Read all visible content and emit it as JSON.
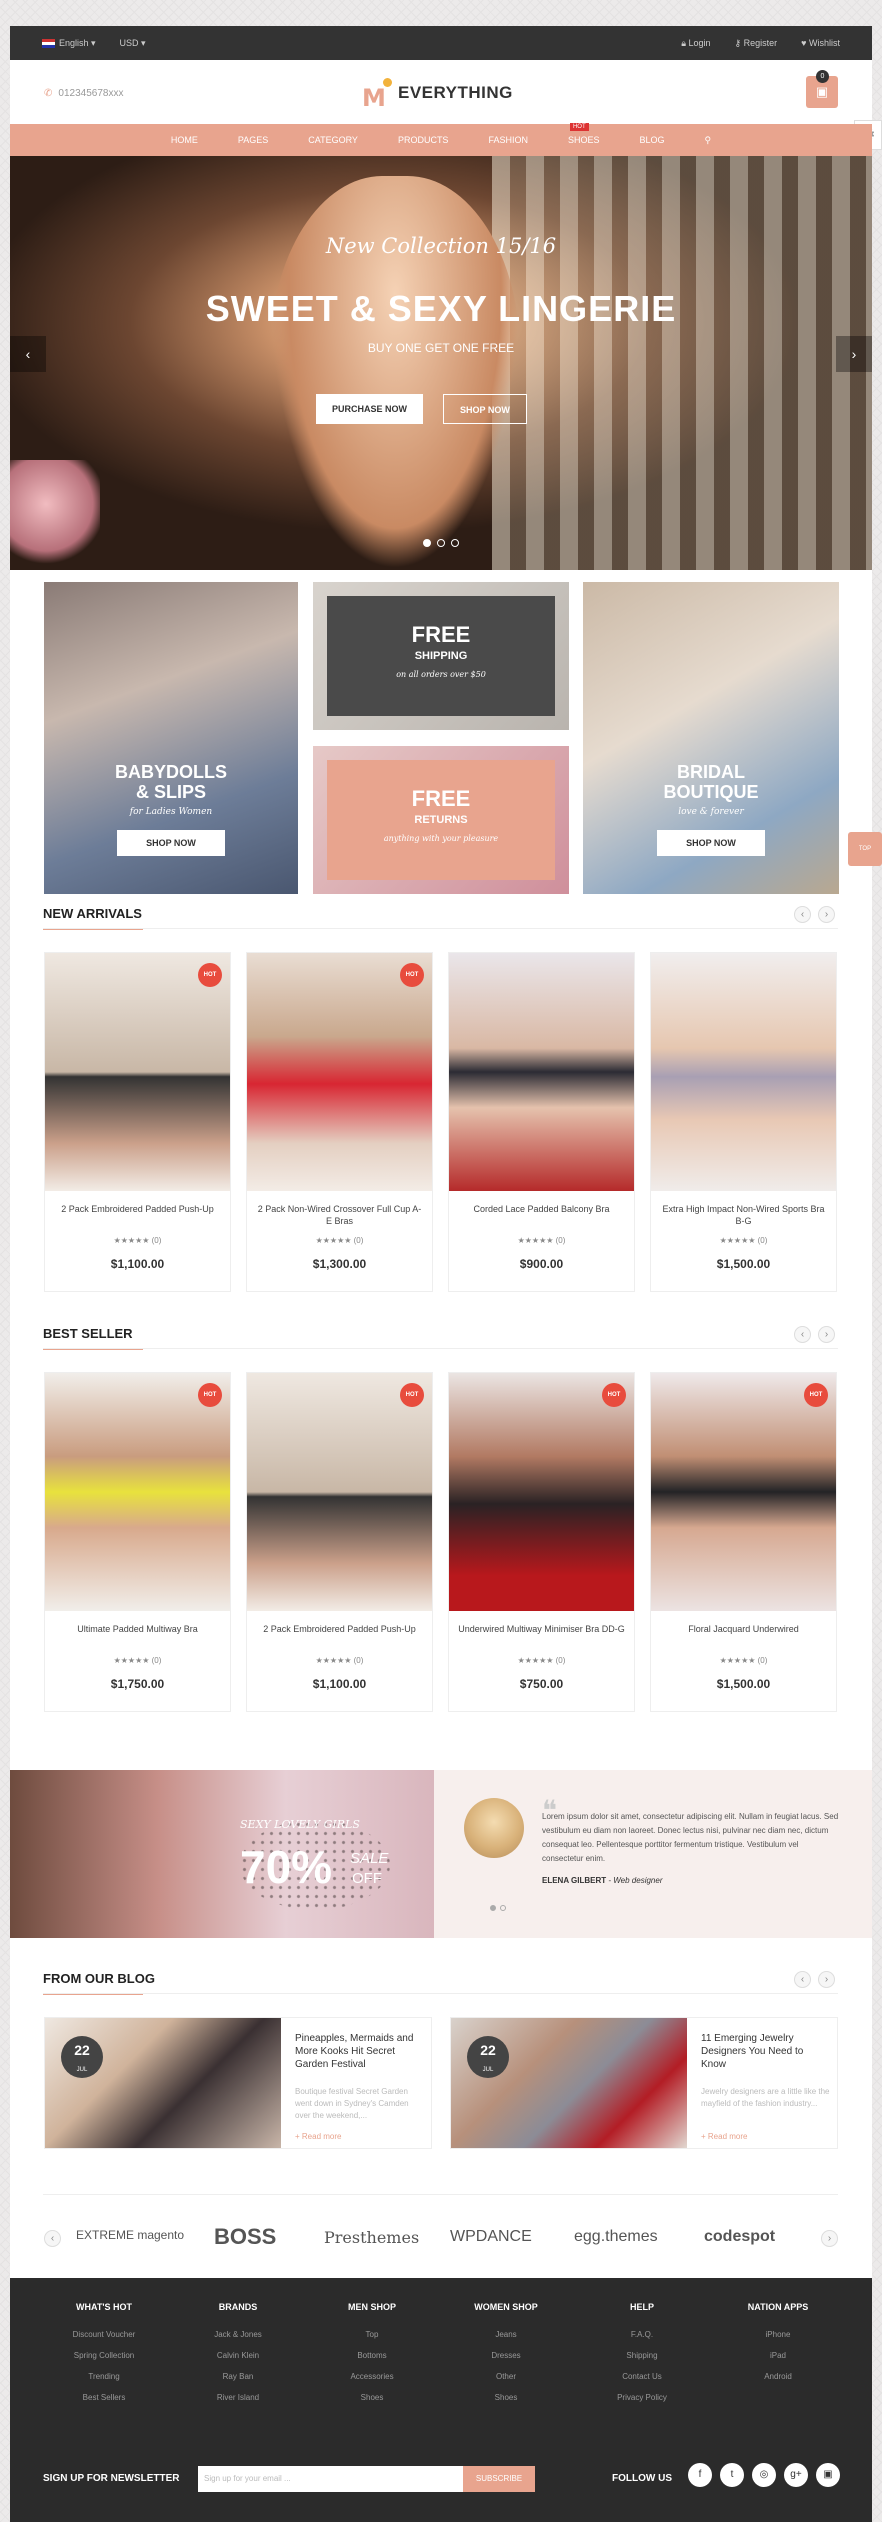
{
  "topbar": {
    "language": "English ▾",
    "currency": "USD ▾",
    "login": "Login",
    "register": "Register",
    "wishlist": "Wishlist"
  },
  "header": {
    "phone": "012345678xxx",
    "logo": "EVERYTHING",
    "cart_count": "0"
  },
  "nav": {
    "items": [
      "HOME",
      "PAGES",
      "CATEGORY",
      "PRODUCTS",
      "FASHION",
      "SHOES",
      "BLOG"
    ],
    "hot": "HOT"
  },
  "hero": {
    "subtitle": "New Collection 15/16",
    "title": "SWEET & SEXY LINGERIE",
    "tagline": "BUY ONE GET ONE FREE",
    "btn_purchase": "PURCHASE NOW",
    "btn_shop": "SHOP NOW"
  },
  "banners": {
    "babydolls": {
      "title": "BABYDOLLS",
      "title2": "& SLIPS",
      "sub": "for Ladies Women",
      "btn": "SHOP NOW"
    },
    "shipping": {
      "big": "FREE",
      "mid": "SHIPPING",
      "small": "on all orders over $50"
    },
    "returns": {
      "big": "FREE",
      "mid": "RETURNS",
      "small": "anything with your pleasure"
    },
    "bridal": {
      "title": "BRIDAL",
      "title2": "BOUTIQUE",
      "sub": "love & forever",
      "btn": "SHOP NOW"
    }
  },
  "new_arrivals": {
    "title": "NEW ARRIVALS",
    "products": [
      {
        "name": "2 Pack Embroidered Padded Push-Up",
        "reviews": "★★★★★ (0)",
        "price": "$1,100.00",
        "hot": "HOT"
      },
      {
        "name": "2 Pack Non-Wired Crossover Full Cup A-E Bras",
        "reviews": "★★★★★ (0)",
        "price": "$1,300.00",
        "hot": "HOT"
      },
      {
        "name": "Corded Lace Padded Balcony Bra",
        "reviews": "★★★★★ (0)",
        "price": "$900.00",
        "hot": ""
      },
      {
        "name": "Extra High Impact Non-Wired Sports Bra B-G",
        "reviews": "★★★★★ (0)",
        "price": "$1,500.00",
        "hot": ""
      }
    ]
  },
  "best_seller": {
    "title": "BEST SELLER",
    "products": [
      {
        "name": "Ultimate Padded Multiway Bra",
        "reviews": "★★★★★ (0)",
        "price": "$1,750.00",
        "hot": "HOT"
      },
      {
        "name": "2 Pack Embroidered Padded Push-Up",
        "reviews": "★★★★★ (0)",
        "price": "$1,100.00",
        "hot": "HOT"
      },
      {
        "name": "Underwired Multiway Minimiser Bra DD-G",
        "reviews": "★★★★★ (0)",
        "price": "$750.00",
        "hot": "HOT"
      },
      {
        "name": "Floral Jacquard Underwired",
        "reviews": "★★★★★ (0)",
        "price": "$1,500.00",
        "hot": "HOT"
      }
    ]
  },
  "promo": {
    "line1": "SEXY LOVELY GIRLS",
    "pct": "70%",
    "sale": "SALE",
    "off": "OFF"
  },
  "testimonial": {
    "text": "Lorem ipsum dolor sit amet, consectetur adipiscing elit. Nullam in feugiat lacus. Sed vestibulum eu diam non laoreet. Donec lectus nisi, pulvinar nec diam nec, dictum consequat leo. Pellentesque porttitor fermentum tristique. Vestibulum vel consectetur enim.",
    "name": "ELENA GILBERT",
    "role": " - Web designer"
  },
  "blog": {
    "title": "FROM OUR BLOG",
    "posts": [
      {
        "day": "22",
        "month": "JUL",
        "title": "Pineapples, Mermaids and More Kooks Hit Secret Garden Festival",
        "excerpt": "Boutique festival Secret Garden went down in Sydney's Camden over the weekend,...",
        "more": "+ Read more"
      },
      {
        "day": "22",
        "month": "JUL",
        "title": "11 Emerging Jewelry Designers You Need to Know",
        "excerpt": "Jewelry designers are a little like the mayfield of the fashion industry...",
        "more": "+ Read more"
      }
    ]
  },
  "brands": [
    "EXTREME magento",
    "BOSS",
    "Presthemes",
    "WPDANCE",
    "egg.themes",
    "codespot"
  ],
  "footer": {
    "columns": [
      {
        "title": "WHAT'S HOT",
        "links": [
          "Discount Voucher",
          "Spring Collection",
          "Trending",
          "Best Sellers"
        ]
      },
      {
        "title": "BRANDS",
        "links": [
          "Jack & Jones",
          "Calvin Klein",
          "Ray Ban",
          "River Island"
        ]
      },
      {
        "title": "MEN SHOP",
        "links": [
          "Top",
          "Bottoms",
          "Accessories",
          "Shoes"
        ]
      },
      {
        "title": "WOMEN SHOP",
        "links": [
          "Jeans",
          "Dresses",
          "Other",
          "Shoes"
        ]
      },
      {
        "title": "HELP",
        "links": [
          "F.A.Q.",
          "Shipping",
          "Contact Us",
          "Privacy Policy"
        ]
      },
      {
        "title": "NATION APPS",
        "links": [
          "iPhone",
          "iPad",
          "Android"
        ]
      }
    ],
    "newsletter_label": "SIGN UP FOR NEWSLETTER",
    "newsletter_placeholder": "Sign up for your email ...",
    "subscribe": "SUBSCRIBE",
    "follow": "FOLLOW US",
    "social": [
      "f",
      "t",
      "◎",
      "g+",
      "▣"
    ]
  },
  "side": {
    "top": "TOP"
  },
  "colors": {
    "accent": "#e8a48e",
    "dark": "#2b2b2b",
    "hot": "#e84c3d"
  }
}
